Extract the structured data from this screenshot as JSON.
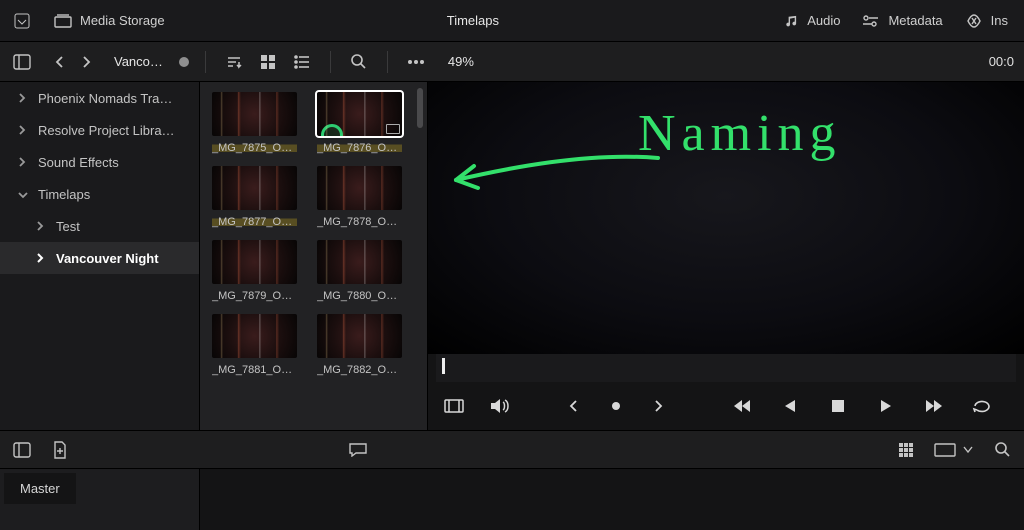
{
  "topbar": {
    "media_storage_label": "Media Storage",
    "title": "Timelaps",
    "audio_label": "Audio",
    "metadata_label": "Metadata",
    "inspector_label": "Ins"
  },
  "toolbar": {
    "breadcrumb": "Vanco…",
    "zoom_pct": "49%",
    "timecode": "00:0"
  },
  "sidebar": {
    "items": [
      {
        "label": "Phoenix Nomads Tra…",
        "expanded": false,
        "indent": 0
      },
      {
        "label": "Resolve Project Libra…",
        "expanded": false,
        "indent": 0
      },
      {
        "label": "Sound Effects",
        "expanded": false,
        "indent": 0
      },
      {
        "label": "Timelaps",
        "expanded": true,
        "indent": 0
      },
      {
        "label": "Test",
        "expanded": false,
        "indent": 1
      },
      {
        "label": "Vancouver Night",
        "expanded": false,
        "indent": 1,
        "active": true
      }
    ]
  },
  "clips": [
    {
      "name": "_MG_7875_O…",
      "hl": true,
      "selected": false
    },
    {
      "name": "_MG_7876_O…",
      "hl": true,
      "selected": true
    },
    {
      "name": "_MG_7877_O…",
      "hl": true,
      "selected": false
    },
    {
      "name": "_MG_7878_O…",
      "hl": false,
      "selected": false
    },
    {
      "name": "_MG_7879_O…",
      "hl": false,
      "selected": false
    },
    {
      "name": "_MG_7880_O…",
      "hl": false,
      "selected": false
    },
    {
      "name": "_MG_7881_O…",
      "hl": false,
      "selected": false
    },
    {
      "name": "_MG_7882_O…",
      "hl": false,
      "selected": false
    }
  ],
  "bottom": {
    "master_label": "Master"
  },
  "annotation": {
    "text": "Naming"
  }
}
